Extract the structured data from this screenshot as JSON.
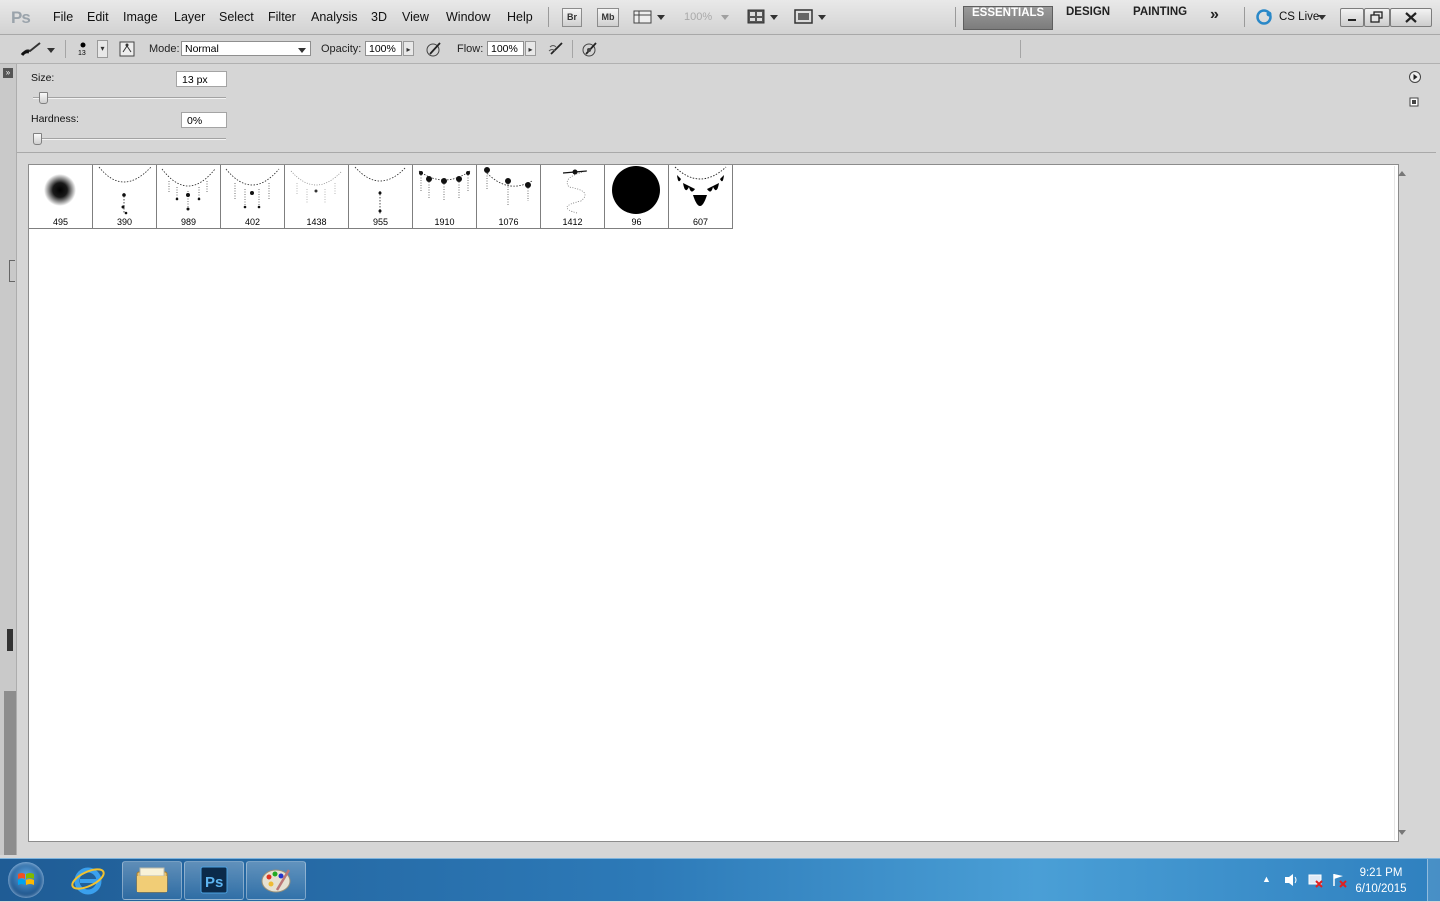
{
  "app": {
    "logo": "Ps"
  },
  "menu": [
    "File",
    "Edit",
    "Image",
    "Layer",
    "Select",
    "Filter",
    "Analysis",
    "3D",
    "View",
    "Window",
    "Help"
  ],
  "menubar_buttons": {
    "bridge": "Br",
    "mini_bridge": "Mb",
    "zoom": "100%"
  },
  "workspaces": {
    "essentials": "ESSENTIALS",
    "design": "DESIGN",
    "painting": "PAINTING",
    "more": "»",
    "cs_live": "CS Live"
  },
  "options": {
    "brush_size_small": "13",
    "mode_label": "Mode:",
    "mode_value": "Normal",
    "opacity_label": "Opacity:",
    "opacity_value": "100%",
    "flow_label": "Flow:",
    "flow_value": "100%"
  },
  "brush_panel": {
    "size_label": "Size:",
    "size_value": "13 px",
    "size_slider": 0.03,
    "hardness_label": "Hardness:",
    "hardness_value": "0%",
    "hardness_slider": 0.0
  },
  "presets": [
    {
      "num": "495",
      "icon": "soft-round-brush-icon"
    },
    {
      "num": "390",
      "icon": "necklace-brush-icon"
    },
    {
      "num": "989",
      "icon": "necklace-brush-icon"
    },
    {
      "num": "402",
      "icon": "necklace-brush-icon"
    },
    {
      "num": "1438",
      "icon": "necklace-brush-icon"
    },
    {
      "num": "955",
      "icon": "necklace-brush-icon"
    },
    {
      "num": "1910",
      "icon": "necklace-brush-icon"
    },
    {
      "num": "1076",
      "icon": "necklace-brush-icon"
    },
    {
      "num": "1412",
      "icon": "necklace-brush-icon"
    },
    {
      "num": "96",
      "icon": "hard-round-brush-icon"
    },
    {
      "num": "607",
      "icon": "necklace-brush-icon"
    }
  ],
  "taskbar": {
    "time": "9:21 PM",
    "date": "6/10/2015"
  },
  "colors": {
    "taskbar": "#2d7ab8",
    "workspace_active": "#8a8a8a",
    "panel": "#d6d6d6"
  }
}
